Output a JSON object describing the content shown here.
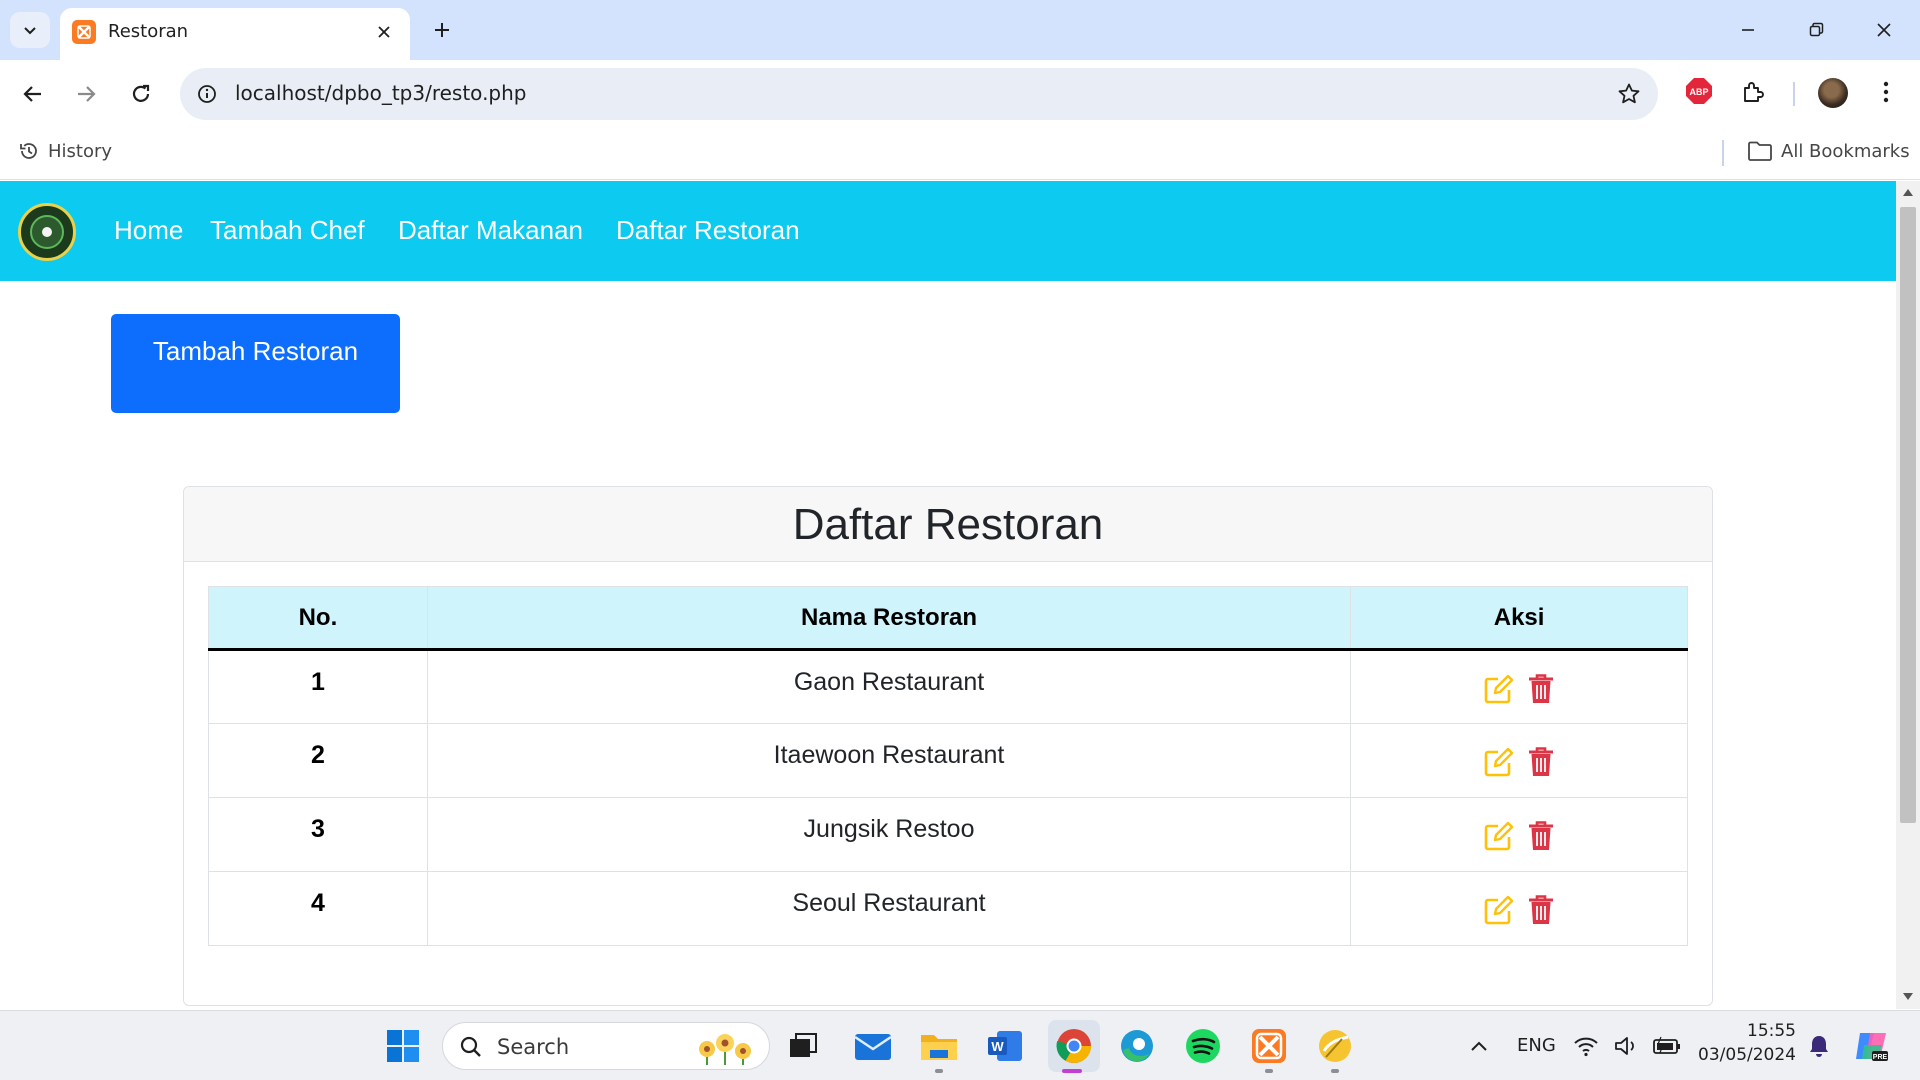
{
  "browser": {
    "tab_title": "Restoran",
    "url": "localhost/dpbo_tp3/resto.php",
    "bookmarks": {
      "history_label": "History",
      "all_bookmarks_label": "All Bookmarks"
    },
    "extension_badge": "ABP"
  },
  "site": {
    "nav": [
      {
        "label": "Home"
      },
      {
        "label": "Tambah Chef"
      },
      {
        "label": "Daftar Makanan"
      },
      {
        "label": "Daftar Restoran"
      }
    ],
    "add_button_label": "Tambah Restoran",
    "card_title": "Daftar Restoran",
    "table": {
      "headers": [
        "No.",
        "Nama Restoran",
        "Aksi"
      ],
      "rows": [
        {
          "no": "1",
          "name": "Gaon Restaurant"
        },
        {
          "no": "2",
          "name": "Itaewoon Restaurant"
        },
        {
          "no": "3",
          "name": "Jungsik Restoo"
        },
        {
          "no": "4",
          "name": "Seoul Restaurant"
        }
      ],
      "row_actions": [
        "edit-icon",
        "delete-icon"
      ]
    },
    "colors": {
      "navbar": "#0dcaf0",
      "primary_button": "#0d6efd",
      "table_header": "#cff4fc",
      "edit_icon": "#ffc107",
      "delete_icon": "#dc3545"
    }
  },
  "taskbar": {
    "search_label": "Search",
    "language": "ENG",
    "time": "15:55",
    "date": "03/05/2024"
  }
}
